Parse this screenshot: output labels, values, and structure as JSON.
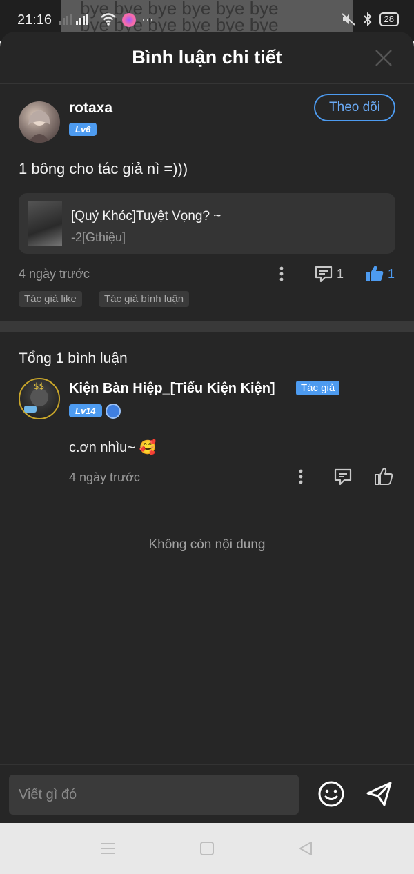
{
  "status_bar": {
    "time": "21:16",
    "battery": "28",
    "banner_text": "bye bye bye bye bye bye"
  },
  "sheet": {
    "title": "Bình luận chi tiết"
  },
  "post": {
    "username": "rotaxa",
    "level": "Lv6",
    "follow_label": "Theo dõi",
    "text": "1 bông cho tác giả nì =)))",
    "novel": {
      "title": "[Quỷ Khóc]Tuyệt Vọng? ~",
      "subtitle": "-2[Gthiệu]"
    },
    "time": "4 ngày trước",
    "comment_count": "1",
    "like_count": "1",
    "tags": [
      "Tác giả like",
      "Tác giả bình luận"
    ]
  },
  "comments_section": {
    "total_label": "Tổng 1 bình luận",
    "items": [
      {
        "name": "Kiện Bàn Hiệp_[Tiểu Kiện Kiện]",
        "badge": "Tác giả",
        "level": "Lv14",
        "text": "c.ơn nhìu~ 🥰",
        "time": "4 ngày trước"
      }
    ],
    "end_label": "Không còn nội dung"
  },
  "composer": {
    "placeholder": "Viết gì đó"
  },
  "colors": {
    "accent": "#4d9bf0",
    "background": "#262626",
    "card": "#343434"
  }
}
